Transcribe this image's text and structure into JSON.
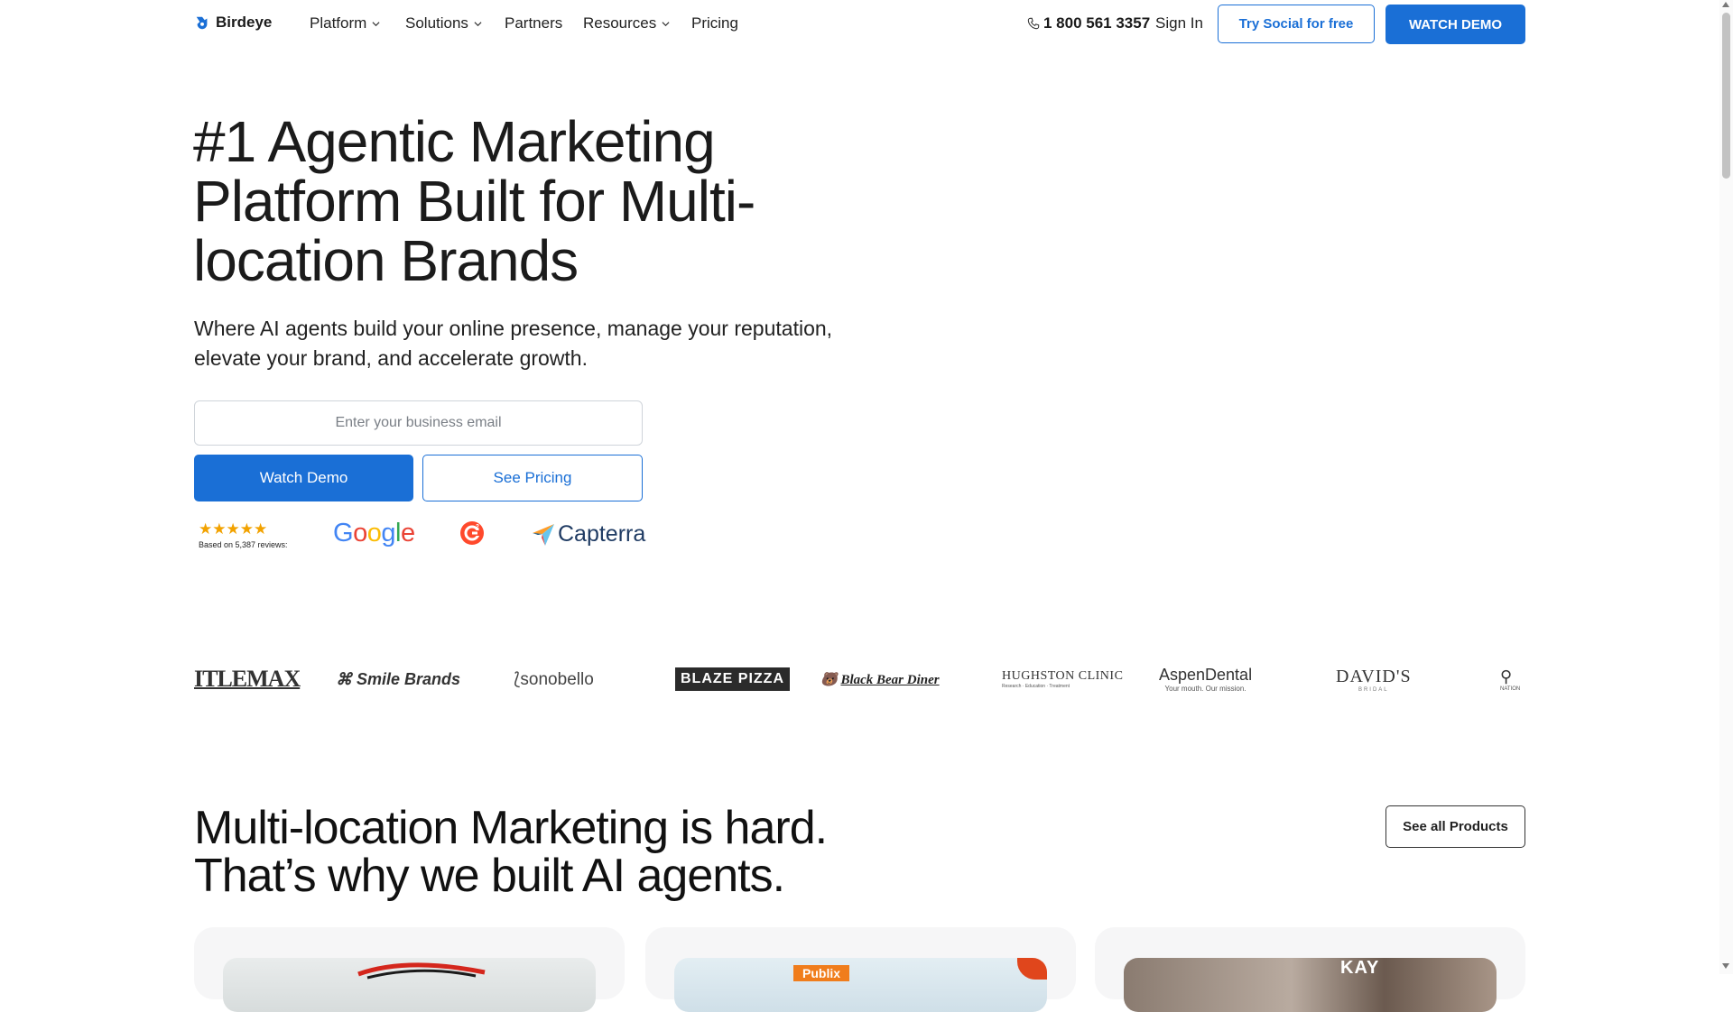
{
  "nav": {
    "logo_text": "Birdeye",
    "items": [
      {
        "label": "Platform",
        "has_dropdown": true
      },
      {
        "label": "Solutions",
        "has_dropdown": true
      },
      {
        "label": "Partners",
        "has_dropdown": false
      },
      {
        "label": "Resources",
        "has_dropdown": true
      },
      {
        "label": "Pricing",
        "has_dropdown": false
      }
    ],
    "phone": "1 800 561 3357",
    "sign_in": "Sign In",
    "try_social": "Try Social for free",
    "watch_demo": "WATCH DEMO"
  },
  "hero": {
    "title": "#1 Agentic Marketing Platform Built for Multi-location Brands",
    "subtitle": "Where AI agents build your online presence, manage your reputation, elevate your brand, and accelerate growth.",
    "email_placeholder": "Enter your business email",
    "watch_demo": "Watch Demo",
    "see_pricing": "See Pricing",
    "rating_stars": "★★★★★",
    "rating_text": "Based on 5,387 reviews:",
    "review_sites": [
      "Google",
      "G2",
      "Capterra"
    ]
  },
  "brands": [
    "ITLEMAX",
    "Smile Brands",
    "sonobello",
    "BLAZE PIZZA",
    "Black Bear Diner",
    "HUGHSTON CLINIC",
    "AspenDental",
    "DAVID'S BRIDAL",
    "NATION"
  ],
  "brand_taglines": {
    "hughston": "Research · Education · Treatment",
    "aspen": "Your mouth. Our mission.",
    "davids": "BRIDAL"
  },
  "section2": {
    "title_line1": "Multi-location Marketing is hard.",
    "title_line2": "That’s why we built AI agents.",
    "see_all": "See all Products",
    "card_labels": [
      "Publix",
      "KAY"
    ]
  },
  "colors": {
    "accent": "#1a6fd6",
    "text": "#1b1b1b",
    "star": "#f2a200"
  }
}
